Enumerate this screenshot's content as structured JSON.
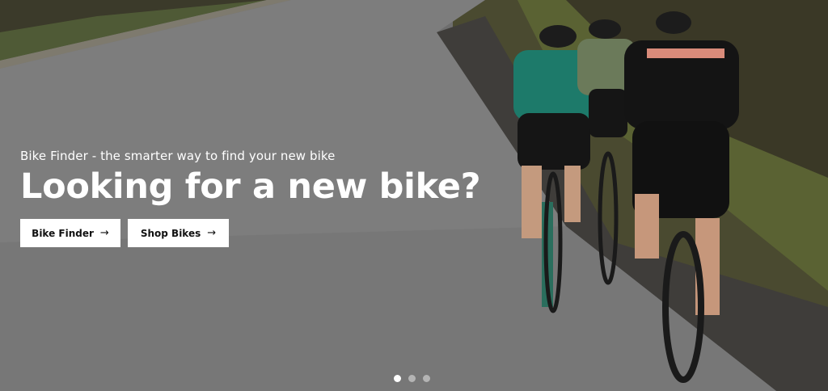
{
  "hero": {
    "subtitle": "Bike Finder - the smarter way to find your new bike",
    "title": "Looking for a new bike?",
    "buttons": [
      {
        "label": "Bike Finder",
        "icon": "arrow-right-icon"
      },
      {
        "label": "Shop Bikes",
        "icon": "arrow-right-icon"
      }
    ],
    "image": "Three road cyclists riding up an asphalt road lined with trees",
    "slider": {
      "count": 3,
      "active_index": 0
    }
  }
}
